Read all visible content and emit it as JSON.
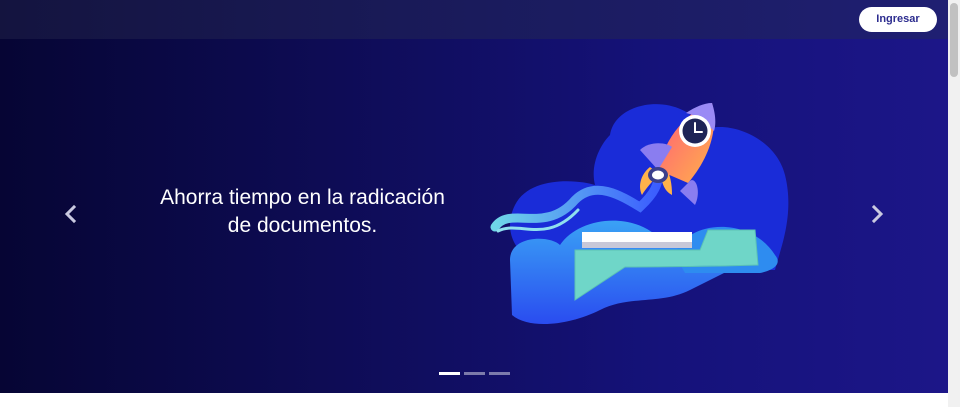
{
  "header": {
    "login_label": "Ingresar"
  },
  "carousel": {
    "slide_text": "Ahorra tiempo en la radicación de documentos.",
    "slide_count": 3,
    "active_slide": 1
  },
  "icons": {
    "prev": "chevron-left-icon",
    "next": "chevron-right-icon",
    "illustration": "rocket-folder-illustration"
  },
  "colors": {
    "hero_start": "#060534",
    "hero_end": "#1c1688",
    "accent_blue": "#1a2cd8",
    "folder_mint": "#6fd6c8",
    "button_text": "#2c2c8f"
  }
}
